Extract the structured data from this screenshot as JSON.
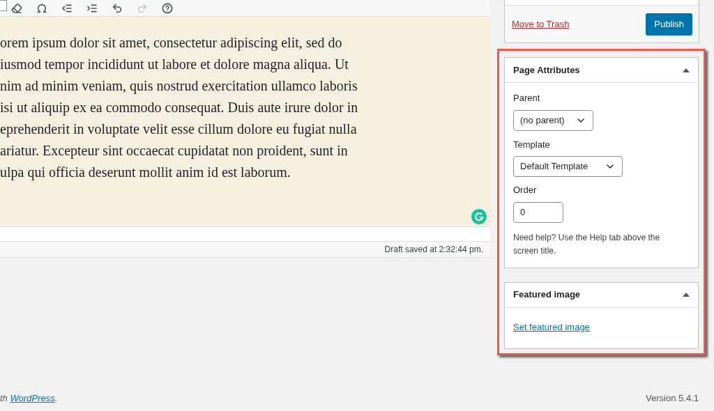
{
  "toolbar": [
    {
      "kind": "eraser",
      "disabled": false
    },
    {
      "kind": "omega",
      "disabled": false
    },
    {
      "kind": "outdent",
      "disabled": false
    },
    {
      "kind": "indent",
      "disabled": false
    },
    {
      "kind": "undo",
      "disabled": false
    },
    {
      "kind": "redo",
      "disabled": true
    },
    {
      "kind": "help",
      "disabled": false
    }
  ],
  "editor": {
    "lines": [
      "orem ipsum dolor sit amet, consectetur adipiscing elit, sed do",
      "iusmod tempor incididunt ut labore et dolore magna aliqua. Ut",
      "nim ad minim veniam, quis nostrud exercitation ullamco laboris",
      "isi ut aliquip ex ea commodo consequat. Duis aute irure dolor in",
      "eprehenderit in voluptate velit esse cillum dolore eu fugiat nulla",
      "ariatur. Excepteur sint occaecat cupidatat non proident, sunt in",
      "ulpa qui officia deserunt mollit anim id est laborum."
    ],
    "status": "Draft saved at 2:32:44 pm."
  },
  "publish_box": {
    "trash_link": "Move to Trash",
    "publish_button": "Publish"
  },
  "page_attributes": {
    "title": "Page Attributes",
    "expanded": true,
    "parent_label": "Parent",
    "parent_value": "(no parent)",
    "template_label": "Template",
    "template_value": "Default Template",
    "order_label": "Order",
    "order_value": "0",
    "help": "Need help? Use the Help tab above the screen title."
  },
  "featured_image": {
    "title": "Featured image",
    "expanded": true,
    "link": "Set featured image"
  },
  "footer": {
    "credit_prefix": "th",
    "credit_link": "WordPress",
    "credit_suffix": ".",
    "version": "Version 5.4.1"
  }
}
